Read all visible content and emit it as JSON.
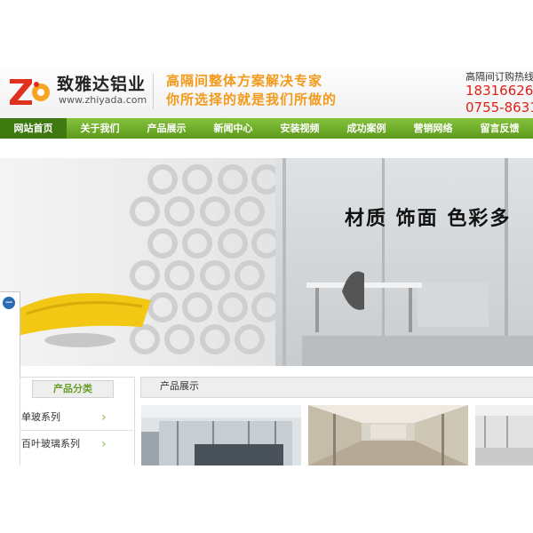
{
  "header": {
    "logo_letters": "Z",
    "brand_name": "致雅达铝业",
    "website": "www.zhiyada.com",
    "slogan_line1": "高隔间整体方案解决专家",
    "slogan_line2": "你所选择的就是我们所做的",
    "hotline_label": "高隔间订购热线",
    "hotline_phone1": "18316626",
    "hotline_phone2": "0755-8631"
  },
  "nav": {
    "items": [
      {
        "label": "网站首页",
        "active": true
      },
      {
        "label": "关于我们"
      },
      {
        "label": "产品展示"
      },
      {
        "label": "新闻中心"
      },
      {
        "label": "安装视频"
      },
      {
        "label": "成功案例"
      },
      {
        "label": "营销网络"
      },
      {
        "label": "留言反馈"
      }
    ]
  },
  "banner": {
    "headline": "材质  饰面  色彩多"
  },
  "sidebar_toggle": {
    "icon": "minus-circle-icon",
    "symbol": "−"
  },
  "categories": {
    "title": "产品分类",
    "items": [
      {
        "label": "单玻系列",
        "arrow": "›"
      },
      {
        "label": "百叶玻璃系列",
        "arrow": "›"
      }
    ]
  },
  "products": {
    "title": "产品展示",
    "thumbnails": [
      "office-partition-photo-1",
      "office-partition-photo-2",
      "office-partition-photo-3"
    ]
  },
  "colors": {
    "nav_green": "#6aa72a",
    "nav_active": "#3f7a10",
    "slogan_orange": "#f39a1b",
    "phone_red": "#e0201a",
    "accent_blue": "#2a6db5"
  }
}
